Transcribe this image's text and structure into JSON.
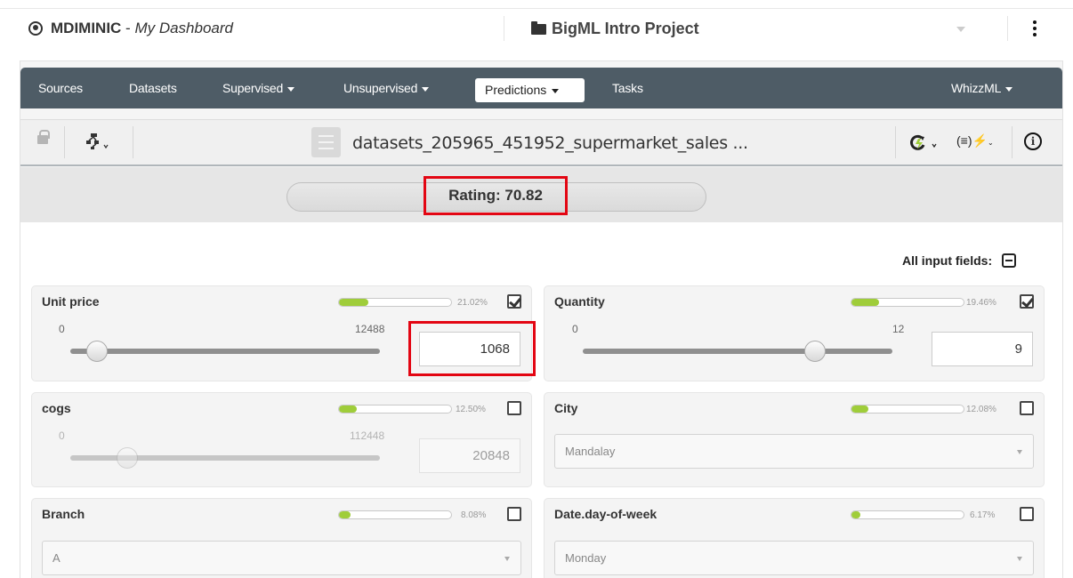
{
  "header": {
    "user": "MDIMINIC",
    "dashboard": "My Dashboard",
    "project": "BigML Intro Project"
  },
  "nav": {
    "items": [
      "Sources",
      "Datasets",
      "Supervised",
      "Unsupervised",
      "Predictions",
      "Tasks",
      "WhizzML"
    ],
    "active": "Predictions"
  },
  "toolbar": {
    "dataset_title": "datasets_205965_451952_supermarket_sales ..."
  },
  "prediction": {
    "rating_label": "Rating: 70.82"
  },
  "inputs": {
    "all_fields_label": "All input fields:",
    "fields": [
      {
        "label": "Unit price",
        "type": "numeric",
        "importance": "21.02%",
        "importance_value": 0.2102,
        "checked": true,
        "min": "0",
        "max": "12488",
        "value": "1068",
        "slider_fraction": 0.085
      },
      {
        "label": "Quantity",
        "type": "numeric",
        "importance": "19.46%",
        "importance_value": 0.1946,
        "checked": true,
        "min": "0",
        "max": "12",
        "value": "9",
        "slider_fraction": 0.75
      },
      {
        "label": "cogs",
        "type": "numeric",
        "importance": "12.50%",
        "importance_value": 0.125,
        "checked": false,
        "min": "0",
        "max": "112448",
        "value": "20848",
        "slider_fraction": 0.185
      },
      {
        "label": "City",
        "type": "categorical",
        "importance": "12.08%",
        "importance_value": 0.1208,
        "checked": false,
        "value": "Mandalay"
      },
      {
        "label": "Branch",
        "type": "categorical",
        "importance": "8.08%",
        "importance_value": 0.0808,
        "checked": false,
        "value": "A"
      },
      {
        "label": "Date.day-of-week",
        "type": "categorical",
        "importance": "6.17%",
        "importance_value": 0.0617,
        "checked": false,
        "value": "Monday"
      }
    ]
  },
  "colors": {
    "navbar": "#4e5c66",
    "importance_fill": "#9fcd3a",
    "highlight": "#e30613"
  }
}
